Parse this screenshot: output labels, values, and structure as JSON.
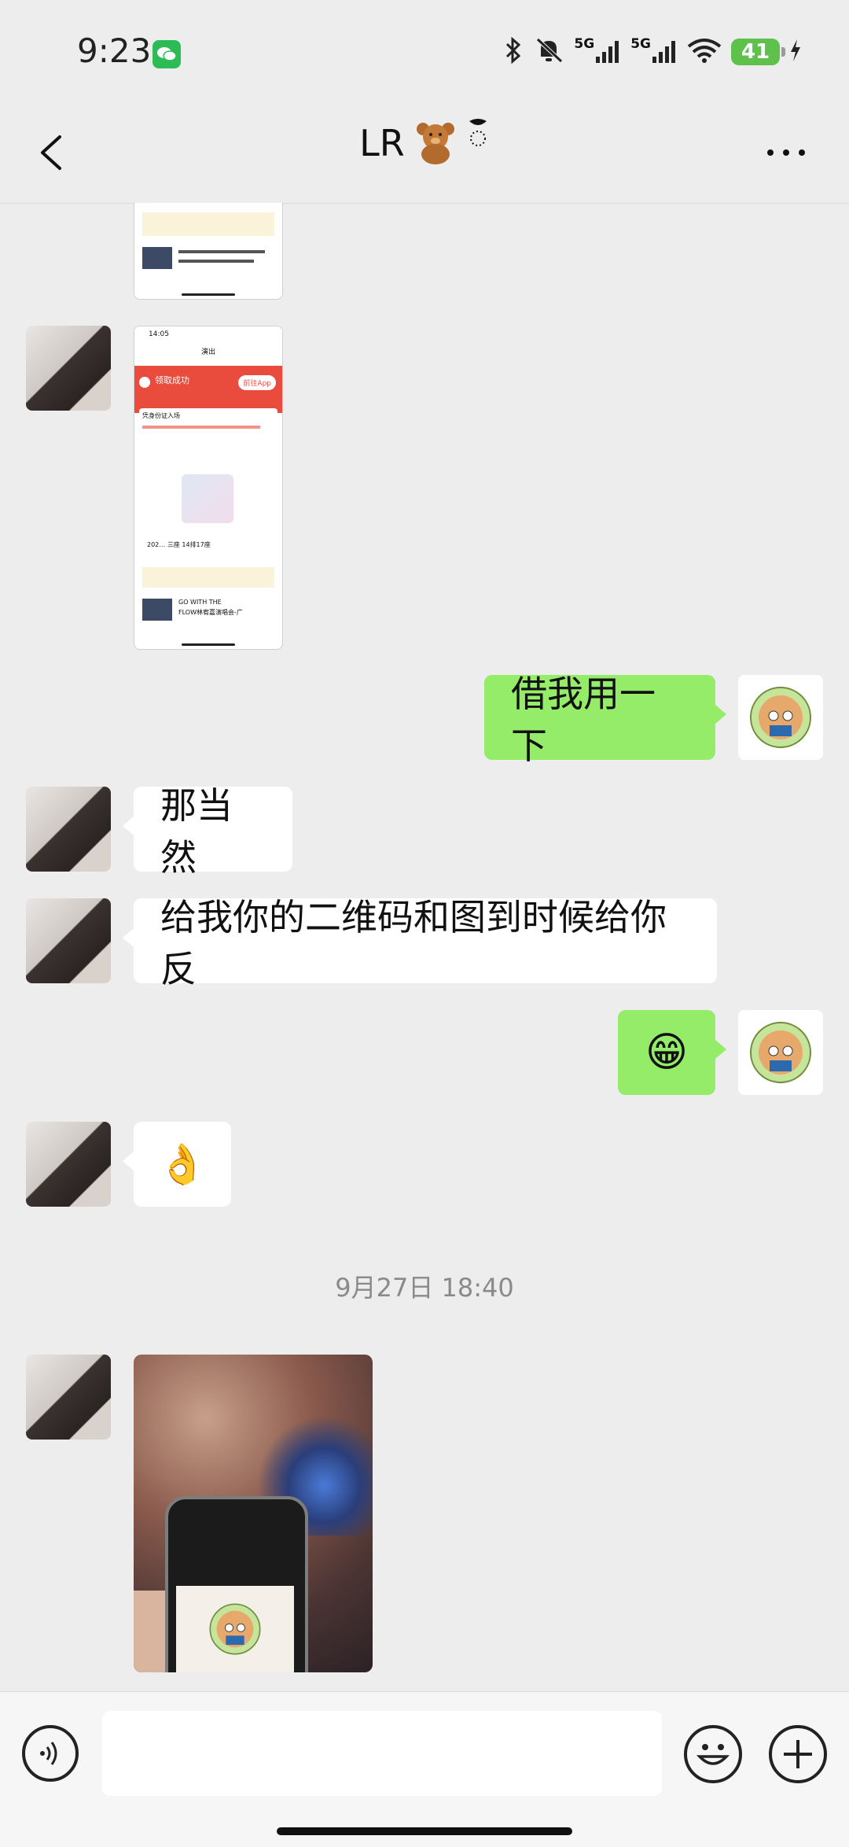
{
  "status_bar": {
    "time": "9:23",
    "net1": "5G",
    "net2": "5G",
    "battery": "41"
  },
  "header": {
    "title": "LR"
  },
  "messages": [
    {
      "from": "contact",
      "type": "screenshot"
    },
    {
      "from": "contact",
      "type": "screenshot",
      "texts": {
        "clock": "14:05",
        "page": "演出",
        "success": "领取成功",
        "open_app": "前往App",
        "cert": "凭身份证入场",
        "date": "202… 三座 14排17座",
        "show1": "GO WITH THE",
        "show2": "FLOW林宥嘉演唱会-广"
      }
    },
    {
      "from": "me",
      "type": "text",
      "text": "借我用一下"
    },
    {
      "from": "contact",
      "type": "text",
      "text": "那当然"
    },
    {
      "from": "contact",
      "type": "text",
      "text": "给我你的二维码和图到时候给你反"
    },
    {
      "from": "me",
      "type": "emoji",
      "text": "😁"
    },
    {
      "from": "contact",
      "type": "emoji",
      "text": "👌"
    }
  ],
  "timestamp": "9月27日 18:40",
  "photo": {
    "from": "contact",
    "type": "image"
  },
  "input": {
    "value": ""
  },
  "colors": {
    "green_bubble": "#95ec69",
    "background": "#ededed",
    "red_banner": "#e94b3c"
  }
}
